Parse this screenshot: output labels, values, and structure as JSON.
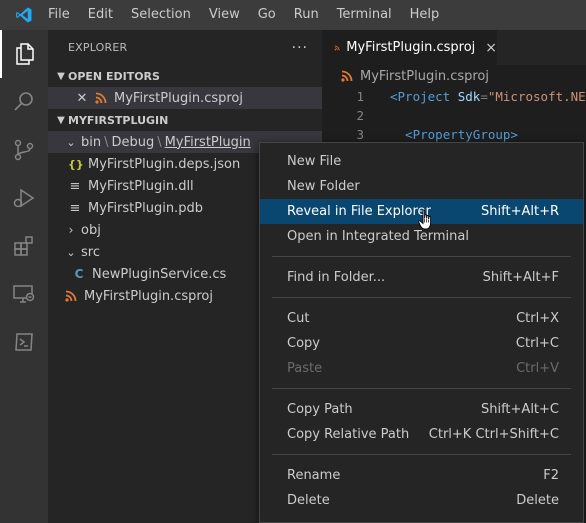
{
  "menubar": {
    "items": [
      "File",
      "Edit",
      "Selection",
      "View",
      "Go",
      "Run",
      "Terminal",
      "Help"
    ]
  },
  "activitybar": {
    "icons": [
      "explorer-icon",
      "search-icon",
      "source-control-icon",
      "run-debug-icon",
      "extensions-icon",
      "remote-explorer-icon",
      "terminal-icon"
    ]
  },
  "sidebar": {
    "title": "EXPLORER",
    "more_label": "···",
    "open_editors": {
      "title": "OPEN EDITORS",
      "items": [
        {
          "label": "MyFirstPlugin.csproj"
        }
      ]
    },
    "project": {
      "title": "MYFIRSTPLUGIN",
      "breadcrumb": [
        "bin",
        "Debug",
        "MyFirstPlugin"
      ],
      "files": [
        {
          "icon": "json",
          "label": "MyFirstPlugin.deps.json"
        },
        {
          "icon": "lines",
          "label": "MyFirstPlugin.dll"
        },
        {
          "icon": "lines",
          "label": "MyFirstPlugin.pdb"
        }
      ],
      "folders": [
        "obj",
        "src"
      ],
      "src_files": [
        {
          "icon": "csharp",
          "label": "NewPluginService.cs"
        }
      ],
      "root_files": [
        {
          "icon": "rss",
          "label": "MyFirstPlugin.csproj"
        }
      ]
    }
  },
  "editor": {
    "tab": {
      "label": "MyFirstPlugin.csproj",
      "close": "×"
    },
    "breadcrumb": "MyFirstPlugin.csproj",
    "lines": [
      {
        "num": "1",
        "tag_open": "<Project",
        "attr": "Sdk",
        "eq": "=",
        "str": "\"Microsoft.NE"
      },
      {
        "num": "2"
      },
      {
        "num": "3",
        "indent": "  ",
        "tag_open": "<PropertyGroup>"
      }
    ]
  },
  "context_menu": {
    "groups": [
      [
        {
          "label": "New File",
          "shortcut": ""
        },
        {
          "label": "New Folder",
          "shortcut": ""
        },
        {
          "label": "Reveal in File Explorer",
          "shortcut": "Shift+Alt+R",
          "highlighted": true
        },
        {
          "label": "Open in Integrated Terminal",
          "shortcut": ""
        }
      ],
      [
        {
          "label": "Find in Folder...",
          "shortcut": "Shift+Alt+F"
        }
      ],
      [
        {
          "label": "Cut",
          "shortcut": "Ctrl+X"
        },
        {
          "label": "Copy",
          "shortcut": "Ctrl+C"
        },
        {
          "label": "Paste",
          "shortcut": "Ctrl+V",
          "disabled": true
        }
      ],
      [
        {
          "label": "Copy Path",
          "shortcut": "Shift+Alt+C"
        },
        {
          "label": "Copy Relative Path",
          "shortcut": "Ctrl+K Ctrl+Shift+C"
        }
      ],
      [
        {
          "label": "Rename",
          "shortcut": "F2"
        },
        {
          "label": "Delete",
          "shortcut": "Delete"
        }
      ]
    ]
  },
  "colors": {
    "accent_highlight": "#094771",
    "rss_orange": "#e37933",
    "vscode_blue": "#23a9f2"
  }
}
